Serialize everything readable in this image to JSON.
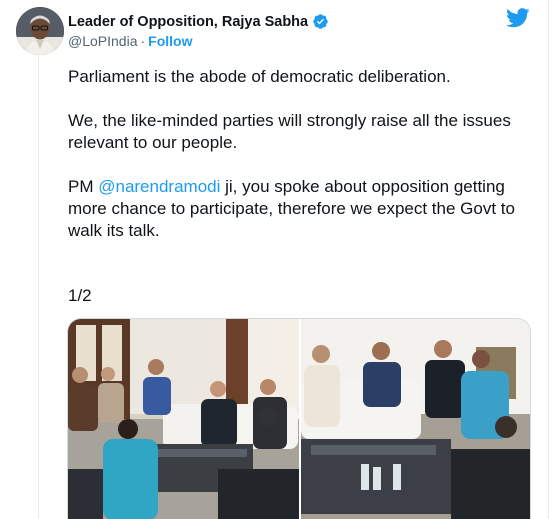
{
  "author": {
    "display_name": "Leader of Opposition, Rajya Sabha",
    "handle": "@LoPIndia",
    "separator": "·",
    "follow_label": "Follow"
  },
  "tweet": {
    "para1": "Parliament is the abode of democratic deliberation.",
    "para2": "We, the like-minded parties will strongly raise all the issues relevant to our people.",
    "para3_before": "PM ",
    "para3_mention": "@narendramodi",
    "para3_after": " ji, you spoke about opposition getting more chance to participate, therefore we expect the Govt to walk its talk.",
    "counter": "1/2"
  },
  "colors": {
    "accent": "#1d9bf0",
    "text": "#0f1419",
    "muted": "#536471"
  },
  "icons": {
    "verified": "verified-badge-icon",
    "twitter": "twitter-bird-icon"
  }
}
